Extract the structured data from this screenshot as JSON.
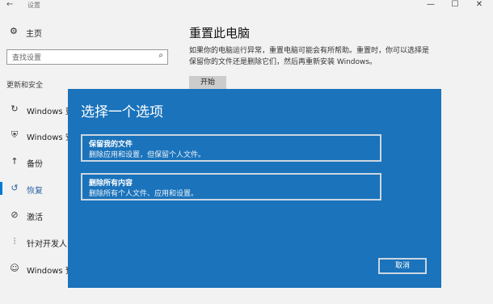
{
  "window": {
    "title": "设置",
    "back_icon": "back-arrow-icon",
    "minimize": "—",
    "maximize": "☐",
    "close": "✕"
  },
  "sidebar": {
    "home_label": "主页",
    "search_placeholder": "查找设置",
    "section_label": "更新和安全",
    "items": [
      {
        "label": "Windows 更新",
        "icon": "sync-icon"
      },
      {
        "label": "Windows 安全中心",
        "icon": "shield-icon"
      },
      {
        "label": "备份",
        "icon": "backup-icon"
      },
      {
        "label": "恢复",
        "icon": "recovery-icon",
        "selected": true
      },
      {
        "label": "激活",
        "icon": "check-circle-icon"
      },
      {
        "label": "针对开发人员",
        "icon": "developer-icon"
      },
      {
        "label": "Windows 预览体验计划",
        "icon": "insider-icon"
      }
    ]
  },
  "content": {
    "title": "重置此电脑",
    "description": "如果你的电脑运行异常，重置电脑可能会有所帮助。重置时，你可以选择是保留你的文件还是删除它们，然后再重新安装 Windows。",
    "start_button": "开始"
  },
  "dialog": {
    "title": "选择一个选项",
    "options": [
      {
        "title": "保留我的文件",
        "desc": "删除应用和设置，但保留个人文件。"
      },
      {
        "title": "删除所有内容",
        "desc": "删除所有个人文件、应用和设置。"
      }
    ],
    "cancel": "取消"
  },
  "colors": {
    "dialog_bg": "#1a73bb",
    "accent": "#0078d7",
    "page_bg": "#f2f2f2"
  }
}
